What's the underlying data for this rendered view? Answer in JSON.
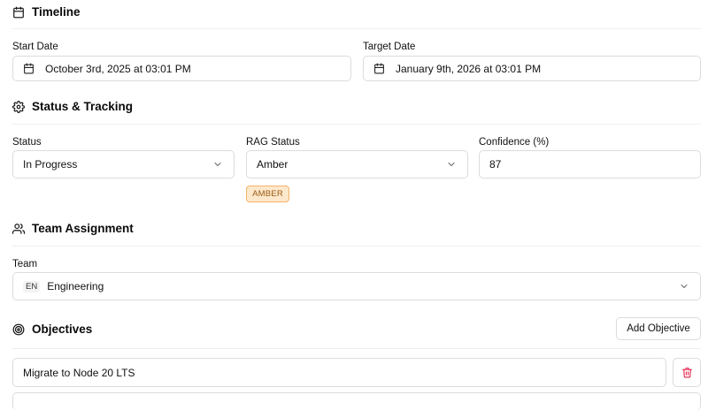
{
  "timeline": {
    "title": "Timeline",
    "start_label": "Start Date",
    "start_value": "October 3rd, 2025 at 03:01 PM",
    "target_label": "Target Date",
    "target_value": "January 9th, 2026 at 03:01 PM"
  },
  "status_tracking": {
    "title": "Status & Tracking",
    "status_label": "Status",
    "status_value": "In Progress",
    "rag_label": "RAG Status",
    "rag_value": "Amber",
    "rag_badge": "AMBER",
    "confidence_label": "Confidence (%)",
    "confidence_value": "87"
  },
  "team_assignment": {
    "title": "Team Assignment",
    "team_label": "Team",
    "team_initials": "EN",
    "team_value": "Engineering"
  },
  "objectives": {
    "title": "Objectives",
    "add_button": "Add Objective",
    "items": [
      {
        "value": "Migrate to Node 20 LTS"
      }
    ]
  },
  "colors": {
    "badge_bg": "#fde8cc",
    "badge_border": "#f3b46b",
    "badge_text": "#9a5a12",
    "delete_icon": "#e11d48"
  }
}
